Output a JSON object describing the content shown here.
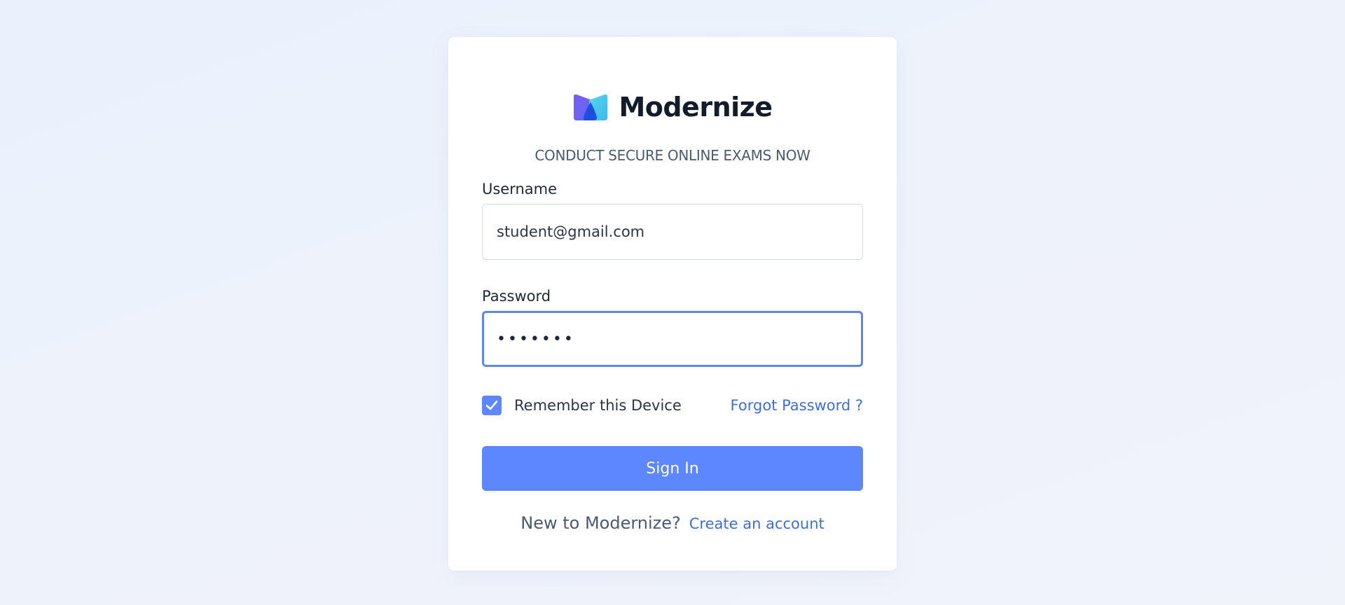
{
  "brand": {
    "name": "Modernize",
    "logo_icon": "modernize-logo-icon",
    "logo_colors": [
      "#6a5cf5",
      "#49bef0",
      "#1f4fe0"
    ]
  },
  "tagline": "CONDUCT SECURE ONLINE EXAMS NOW",
  "form": {
    "username_label": "Username",
    "username_value": "student@gmail.com",
    "password_label": "Password",
    "password_display": "•••••••",
    "remember_label": "Remember this Device",
    "remember_checked": true,
    "forgot_label": "Forgot Password ?",
    "signin_label": "Sign In"
  },
  "footer": {
    "prompt": "New to Modernize?",
    "create_label": "Create an account"
  },
  "colors": {
    "accent": "#5d87ff",
    "link": "#3d6fd9",
    "focus_border": "#5d87e8",
    "background": "#eef2fb"
  }
}
